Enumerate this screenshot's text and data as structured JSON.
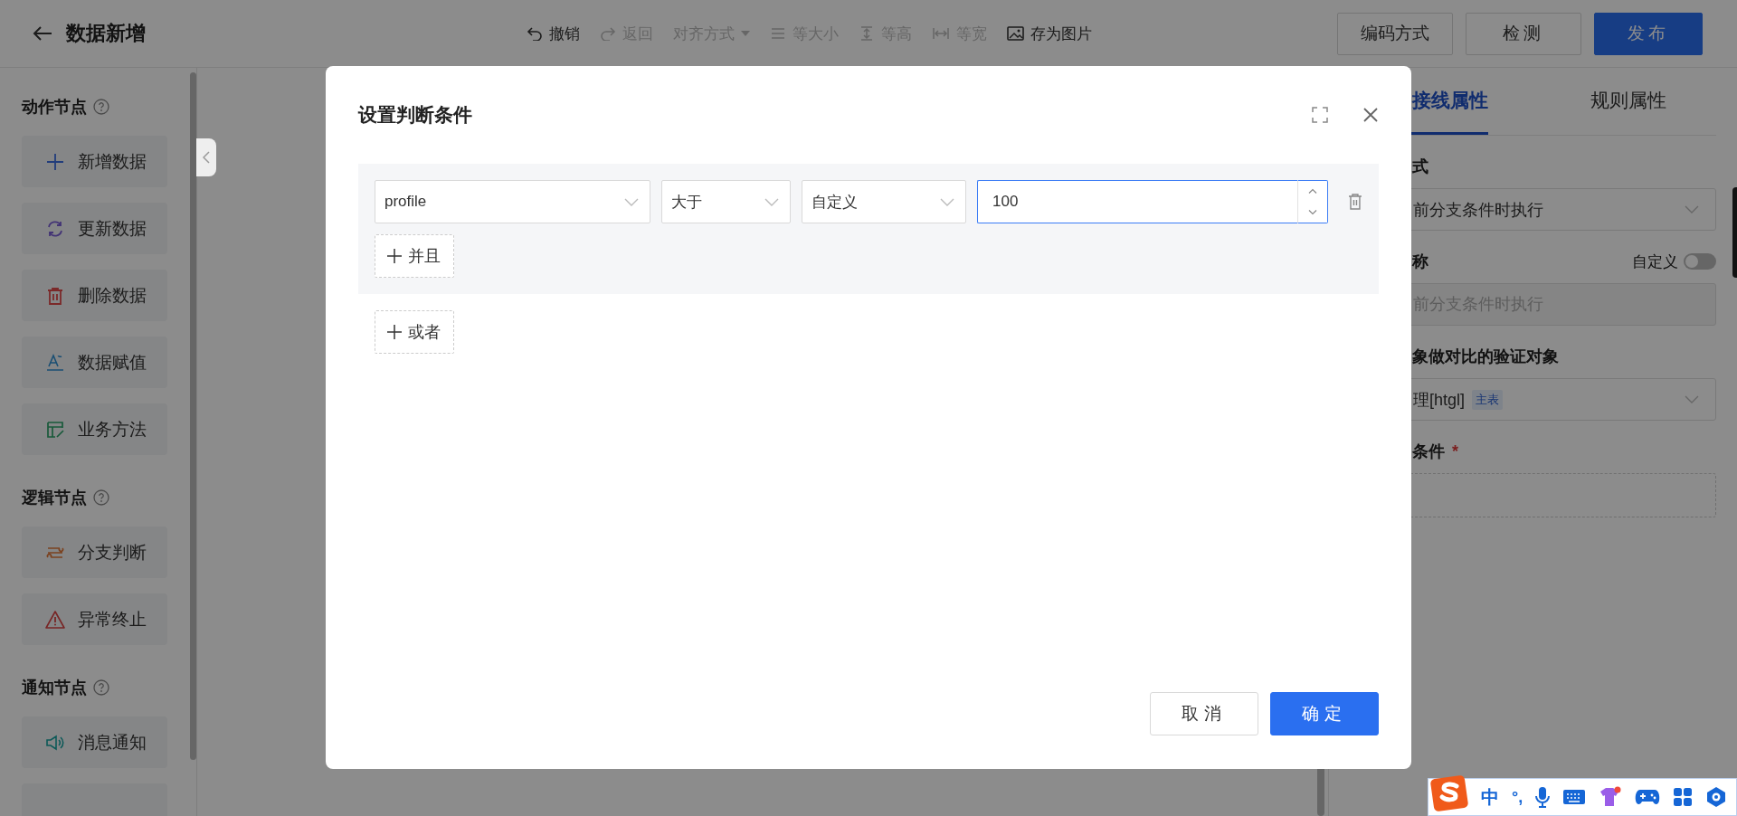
{
  "header": {
    "title": "数据新增",
    "toolbar": [
      {
        "label": "撤销",
        "kind": "button",
        "disabled": false
      },
      {
        "label": "返回",
        "kind": "button",
        "disabled": true
      },
      {
        "label": "对齐方式",
        "kind": "dropdown",
        "disabled": true
      },
      {
        "label": "等大小",
        "kind": "button",
        "disabled": true
      },
      {
        "label": "等高",
        "kind": "button",
        "disabled": true
      },
      {
        "label": "等宽",
        "kind": "button",
        "disabled": true
      },
      {
        "label": "存为图片",
        "kind": "button",
        "disabled": false
      }
    ],
    "buttons": [
      {
        "label": "编码方式",
        "kind": "default"
      },
      {
        "label": "检测",
        "kind": "default"
      },
      {
        "label": "发布",
        "kind": "primary"
      }
    ]
  },
  "sidebar": {
    "sections": [
      {
        "title": "动作节点",
        "items": [
          {
            "label": "新增数据"
          },
          {
            "label": "更新数据"
          },
          {
            "label": "删除数据"
          },
          {
            "label": "数据赋值"
          },
          {
            "label": "业务方法"
          }
        ]
      },
      {
        "title": "逻辑节点",
        "items": [
          {
            "label": "分支判断"
          },
          {
            "label": "异常终止"
          }
        ]
      },
      {
        "title": "通知节点",
        "items": [
          {
            "label": "消息通知"
          }
        ]
      }
    ]
  },
  "right_panel": {
    "tabs": [
      {
        "label": "接线属性",
        "selected": true
      },
      {
        "label": "规则属性",
        "selected": false
      }
    ],
    "fields": [
      {
        "kind": "select",
        "label": "式",
        "value": "前分支条件时执行"
      },
      {
        "kind": "input",
        "label": "称",
        "toggle": {
          "label": "自定义",
          "on": false
        },
        "placeholder": "前分支条件时执行"
      },
      {
        "kind": "select",
        "label": "象做对比的验证对象",
        "value": "理[htgl]",
        "badge": "主表"
      },
      {
        "kind": "area",
        "label": "条件",
        "required_mark": "*"
      }
    ]
  },
  "dialog": {
    "title": "设置判断条件",
    "groups": [
      {
        "conditions": [
          {
            "field": "profile",
            "operator": "大于",
            "value_type": "自定义",
            "value": "100",
            "focused": true
          }
        ],
        "and_button": "并且"
      }
    ],
    "or_button": "或者",
    "buttons": [
      {
        "label": "取消",
        "kind": "default"
      },
      {
        "label": "确定",
        "kind": "primary"
      }
    ]
  },
  "ime_bar": {
    "mode": "中",
    "punctuation": "°,"
  }
}
